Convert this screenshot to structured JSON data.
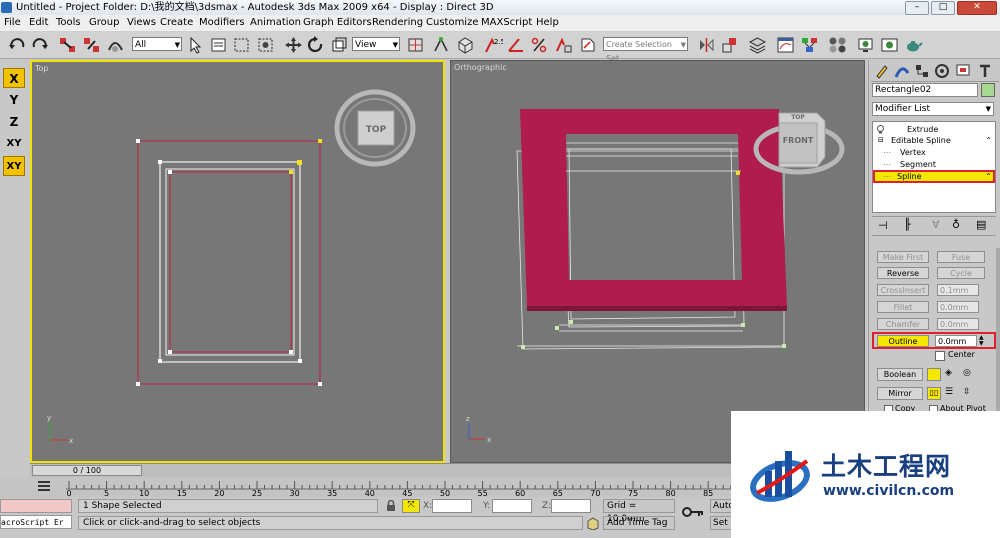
{
  "titlebar": {
    "title": "Untitled     - Project Folder: D:\\我的文档\\3dsmax     - Autodesk 3ds Max  2009 x64     - Display : Direct 3D",
    "minimize": "–",
    "maximize": "□",
    "close": "✕"
  },
  "menu": [
    "File",
    "Edit",
    "Tools",
    "Group",
    "Views",
    "Create",
    "Modifiers",
    "Animation",
    "Graph Editors",
    "Rendering",
    "Customize",
    "MAXScript",
    "Help"
  ],
  "toolbar": {
    "selection_filter": "All",
    "ref_coord": "View",
    "snap_value": "2.5",
    "named_selection_placeholder": "Create Selection Set"
  },
  "axis_constraints": [
    "X",
    "Y",
    "Z",
    "XY",
    "XY"
  ],
  "viewports": {
    "top": {
      "label": "Top",
      "cube_label": "TOP"
    },
    "ortho": {
      "label": "Orthographic",
      "cube_top": "TOP",
      "cube_front": "FRONT"
    }
  },
  "command_panel": {
    "object_name": "Rectangle02",
    "object_color": "#a6d890",
    "modifier_list": "Modifier List",
    "stack": [
      {
        "label": "Extrude",
        "type": "modifier"
      },
      {
        "label": "Editable Spline",
        "type": "base"
      },
      {
        "label": "Vertex",
        "type": "sub"
      },
      {
        "label": "Segment",
        "type": "sub"
      },
      {
        "label": "Spline",
        "type": "sub-selected"
      }
    ],
    "buttons": {
      "make_first": "Make First",
      "fuse": "Fuse",
      "reverse": "Reverse",
      "cycle": "Cycle",
      "crossinsert": "CrossInsert",
      "fillet": "Fillet",
      "chamfer": "Chamfer",
      "outline": "Outline",
      "boolean": "Boolean",
      "mirror": "Mirror"
    },
    "values": {
      "crossinsert": "0.1mm",
      "fillet": "0.0mm",
      "chamfer": "0.0mm",
      "outline": "0.0mm"
    },
    "center_label": "Center",
    "copy_label": "Copy",
    "about_pivot_label": "About Pivot",
    "highlight_color": "#e0202a"
  },
  "timeline": {
    "frame_readout": "0 / 100",
    "ticks": [
      "0",
      "5",
      "10",
      "15",
      "20",
      "25",
      "30",
      "35",
      "40",
      "45",
      "50",
      "55",
      "60",
      "65",
      "70",
      "75",
      "80",
      "85"
    ]
  },
  "status": {
    "maxscript_stub": "acroScript Er",
    "selection": "1 Shape Selected",
    "prompt": "Click or click-and-drag to select objects",
    "x_label": "X:",
    "y_label": "Y:",
    "z_label": "Z:",
    "grid": "Grid = 10.0mm",
    "add_time_tag": "Add Time Tag",
    "auto_key": "Auto",
    "set_key": "Set K"
  },
  "watermark": {
    "title": "土木工程网",
    "url": "www.civilcn.com"
  }
}
